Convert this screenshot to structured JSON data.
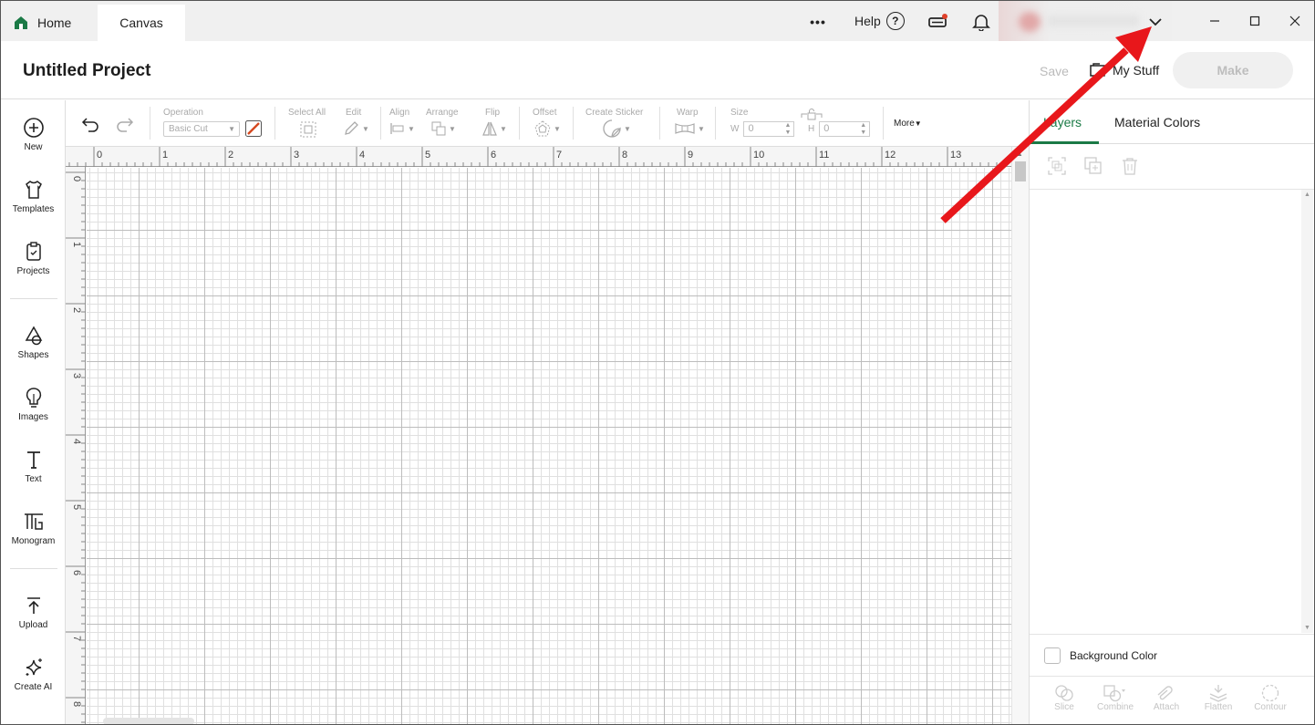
{
  "titlebar": {
    "tabs": [
      {
        "label": "Home"
      },
      {
        "label": "Canvas"
      }
    ],
    "more_label": "•••",
    "help_label": "Help",
    "help_q": "?"
  },
  "project": {
    "title": "Untitled Project",
    "save_label": "Save",
    "mystuff_label": "My Stuff",
    "make_label": "Make"
  },
  "rail": {
    "items": [
      {
        "label": "New",
        "icon": "plus-circle-icon"
      },
      {
        "label": "Templates",
        "icon": "shirt-icon"
      },
      {
        "label": "Projects",
        "icon": "clipboard-icon"
      },
      {
        "label": "Shapes",
        "icon": "shapes-icon"
      },
      {
        "label": "Images",
        "icon": "lightbulb-icon"
      },
      {
        "label": "Text",
        "icon": "text-icon"
      },
      {
        "label": "Monogram",
        "icon": "monogram-icon"
      },
      {
        "label": "Upload",
        "icon": "upload-icon"
      },
      {
        "label": "Create AI",
        "icon": "sparkle-icon"
      }
    ]
  },
  "toolbar": {
    "operation_label": "Operation",
    "operation_value": "Basic Cut",
    "select_all_label": "Select All",
    "edit_label": "Edit",
    "align_label": "Align",
    "arrange_label": "Arrange",
    "flip_label": "Flip",
    "offset_label": "Offset",
    "create_sticker_label": "Create Sticker",
    "warp_label": "Warp",
    "size_label": "Size",
    "w_label": "W",
    "w_value": "0",
    "h_label": "H",
    "h_value": "0",
    "more_label": "More"
  },
  "ruler": {
    "h": [
      "0",
      "1",
      "2",
      "3",
      "4",
      "5",
      "6",
      "7",
      "8",
      "9",
      "10",
      "11",
      "12",
      "13"
    ],
    "v": [
      "0",
      "1",
      "2",
      "3",
      "4",
      "5",
      "6",
      "7",
      "8"
    ]
  },
  "panel": {
    "tabs": [
      {
        "label": "Layers"
      },
      {
        "label": "Material Colors"
      }
    ],
    "background_color_label": "Background Color",
    "bottom_actions": [
      {
        "label": "Slice"
      },
      {
        "label": "Combine"
      },
      {
        "label": "Attach"
      },
      {
        "label": "Flatten"
      },
      {
        "label": "Contour"
      }
    ]
  },
  "colors": {
    "brand_green": "#1b7a46",
    "annotation_red": "#e8171b",
    "notification_dot": "#e0412a"
  }
}
